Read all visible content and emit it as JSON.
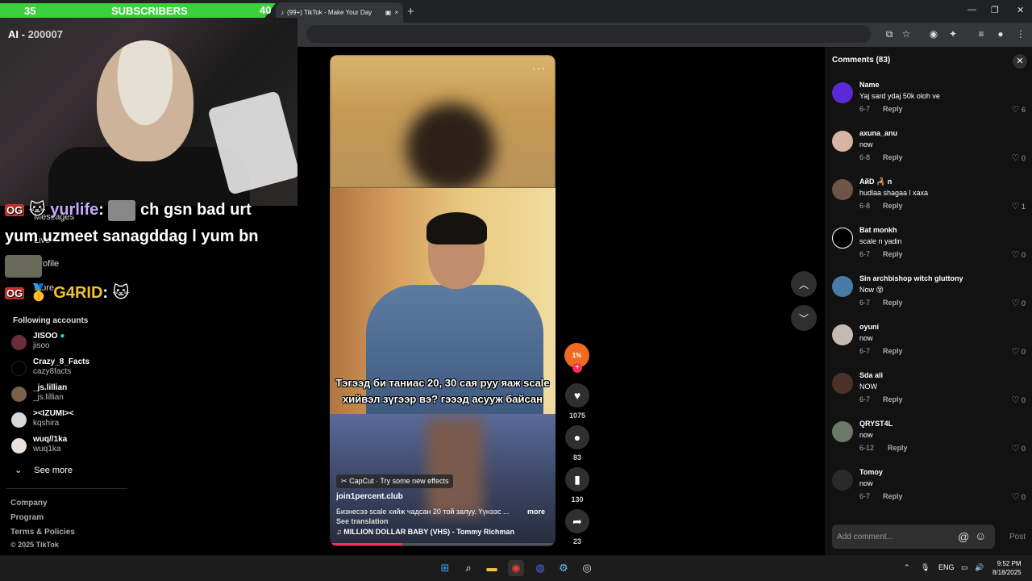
{
  "browser": {
    "tab_title": "(99+) TikTok - Make Your Day",
    "tab_close": "×",
    "new_tab": "+",
    "win_minimize": "—",
    "win_restore": "❐",
    "win_close": "✕"
  },
  "stream_overlay": {
    "subs_current": "35",
    "subs_label": "SUBSCRIBERS",
    "subs_goal": "40",
    "ai_label": "AI - ",
    "ai_value": "200007",
    "chat": [
      {
        "badge": "OG",
        "name": "yurlife",
        "sep": ":",
        "message_1": "ch gsn bad urt",
        "message_2": "yum uzmeet sanagddag l yum bn"
      },
      {
        "badge": "OG",
        "name": "G4RID",
        "sep": ":",
        "message_1": ""
      }
    ]
  },
  "sidebar": {
    "nav_items": [
      "Messages",
      "Live",
      "Profile",
      "More"
    ],
    "following_heading": "Following accounts",
    "accounts": [
      {
        "display": "JISOO",
        "handle": "jisoo",
        "verified": true,
        "color": "#6b2d3b"
      },
      {
        "display": "Crazy_8_Facts",
        "handle": "cazy8facts",
        "verified": false,
        "color": "#000000"
      },
      {
        "display": "_js.lillian",
        "handle": "_js.lillian",
        "verified": false,
        "color": "#7a6048"
      },
      {
        "display": "><IZUMI><",
        "handle": "kqshira",
        "verified": false,
        "color": "#d8d8d8"
      },
      {
        "display": "wuq//1ka",
        "handle": "wuq1ka",
        "verified": false,
        "color": "#e9e2dc"
      }
    ],
    "see_more": "See more",
    "footer": [
      "Company",
      "Program",
      "Terms & Policies",
      "© 2025 TikTok"
    ]
  },
  "video": {
    "more_dots": "···",
    "subtitle_line1": "Тэгээд би таниас 20, 30 сая руу яаж scale",
    "subtitle_line2": "хийвэл зүгээр вэ? гэээд асууж байсан",
    "capcut": "CapCut · Try some new effects",
    "author": "join1percent.club",
    "description": "Бизнесээ scale хийж чадсан 20 той залуу. Үүнээс ...",
    "more": "more",
    "see_translation": "See translation",
    "music": "MILLION DOLLAR BABY (VHS) - Tommy Richman",
    "progress": 0.32
  },
  "actions": {
    "likes": "1075",
    "comments": "83",
    "saves": "130",
    "shares": "23",
    "creator_avatar_text": "1%"
  },
  "comments_panel": {
    "title": "Comments (83)",
    "close": "✕",
    "reply_label": "Reply",
    "items": [
      {
        "user": "Name",
        "text": "Yaj sard ydaj 50k oloh ve",
        "date": "6-7",
        "likes": "6",
        "avatar_color": "#5a2ad8"
      },
      {
        "user": "axuna_anu",
        "text": "now",
        "date": "6-8",
        "likes": "0",
        "avatar_color": "#d9b4a4"
      },
      {
        "user": "АйD 🦂 n",
        "text": "hudlaa shagaa l xaxa",
        "date": "6-8",
        "likes": "1",
        "avatar_color": "#6e5448"
      },
      {
        "user": "Bat monkh",
        "text": "scale n yadin",
        "date": "6-7",
        "likes": "0",
        "avatar_color": "#000000"
      },
      {
        "user": "Sin archbishop witch gluttony",
        "text": "Now 😵",
        "date": "6-7",
        "likes": "0",
        "avatar_color": "#4a7aa8"
      },
      {
        "user": "oyuni",
        "text": "now",
        "date": "6-7",
        "likes": "0",
        "avatar_color": "#c7bab0"
      },
      {
        "user": "Sda ali",
        "text": "NOW",
        "date": "6-7",
        "likes": "0",
        "avatar_color": "#4a3228"
      },
      {
        "user": "QRYST4L",
        "text": "now",
        "date": "6-12",
        "likes": "0",
        "avatar_color": "#6b7a66"
      },
      {
        "user": "Tomoy",
        "text": "now",
        "date": "6-7",
        "likes": "0",
        "avatar_color": "#2a2a2a"
      }
    ],
    "input_placeholder": "Add comment...",
    "post": "Post"
  },
  "taskbar": {
    "lang": "ENG",
    "time": "9:52 PM",
    "date": "8/18/2025"
  },
  "colors": {
    "accent": "#fe2c55",
    "subs_bar": "#3cd13c"
  }
}
